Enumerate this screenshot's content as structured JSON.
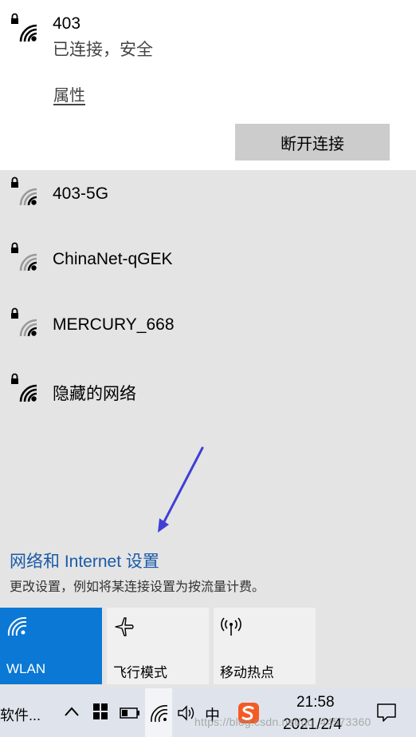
{
  "connected_network": {
    "name": "403",
    "status": "已连接，安全",
    "properties_label": "属性",
    "disconnect_label": "断开连接"
  },
  "networks": [
    {
      "name": "403-5G"
    },
    {
      "name": "ChinaNet-qGEK"
    },
    {
      "name": "MERCURY_668"
    },
    {
      "name": "隐藏的网络"
    }
  ],
  "settings": {
    "link_label": "网络和 Internet 设置",
    "description": "更改设置，例如将某连接设置为按流量计费。"
  },
  "quick_actions": {
    "wlan_label": "WLAN",
    "airplane_label": "飞行模式",
    "hotspot_label": "移动热点"
  },
  "taskbar": {
    "app_label": "软件...",
    "ime_label": "中",
    "time": "21:58",
    "date": "2021/2/4"
  },
  "watermark": "https://blog.csdn.net/qq_44573360",
  "colors": {
    "accent": "#0a78d4",
    "link": "#1a5aa8",
    "arrow": "#3f3fd6"
  }
}
